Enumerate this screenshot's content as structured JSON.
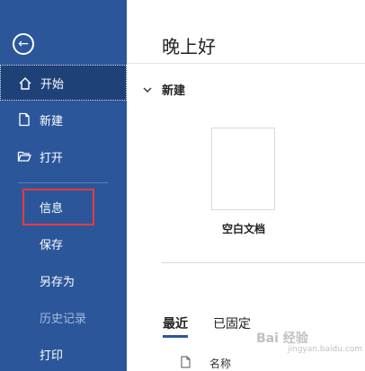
{
  "sidebar": {
    "back_icon": "back-arrow-icon",
    "items": [
      {
        "label": "开始",
        "icon": "home-icon"
      },
      {
        "label": "新建",
        "icon": "new-document-icon"
      },
      {
        "label": "打开",
        "icon": "folder-open-icon"
      },
      {
        "label": "信息"
      },
      {
        "label": "保存"
      },
      {
        "label": "另存为"
      },
      {
        "label": "历史记录"
      },
      {
        "label": "打印"
      }
    ]
  },
  "main": {
    "greeting": "晚上好",
    "new_section": "新建",
    "template_label": "空白文档",
    "tabs": [
      {
        "label": "最近"
      },
      {
        "label": "已固定"
      }
    ],
    "column_name": "名称"
  },
  "watermark": {
    "text": "Bai 经验",
    "sub": "jingyan.baidu.com"
  },
  "colors": {
    "sidebar": "#2b579a",
    "active": "#1e4178",
    "highlight": "#e8393b"
  }
}
